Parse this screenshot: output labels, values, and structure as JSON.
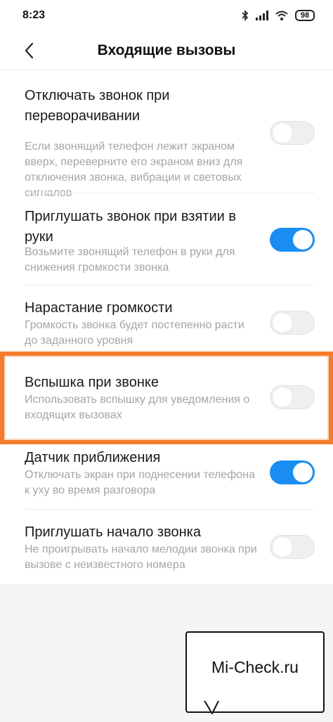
{
  "status_bar": {
    "time": "8:23",
    "battery": "98",
    "icons": [
      "bluetooth-icon",
      "signal-icon",
      "wifi-icon",
      "battery-icon"
    ]
  },
  "header": {
    "title": "Входящие вызовы",
    "back_icon": "chevron-left-icon"
  },
  "settings": [
    {
      "title": "Отключать звонок при переворачивании",
      "description": "Если звонящий телефон лежит экраном вверх, переверните его экраном вниз для отключения звонка, вибрации и световых сигналов",
      "enabled": false
    },
    {
      "title": "Приглушать звонок при взятии в руки",
      "description": "Возьмите звонящий телефон в руки для снижения громкости звонка",
      "enabled": true
    },
    {
      "title": "Нарастание громкости",
      "description": "Громкость звонка будет постепенно расти до заданного уровня",
      "enabled": false
    },
    {
      "title": "Вспышка при звонке",
      "description": "Использовать вспышку для уведомления о входящих вызовах",
      "enabled": false,
      "highlighted": true
    },
    {
      "title": "Датчик приближения",
      "description": "Отключать экран при поднесении телефона к уху во время разговора",
      "enabled": true
    },
    {
      "title": "Приглушать начало звонка",
      "description": "Не проигрывать начало мелодии звонка при вызове с неизвестного номера",
      "enabled": false
    }
  ],
  "watermark": {
    "text": "Mi-Check.ru"
  },
  "colors": {
    "toggle_on": "#1a8df2",
    "toggle_off": "#efefef",
    "highlight": "#f47c2c"
  }
}
